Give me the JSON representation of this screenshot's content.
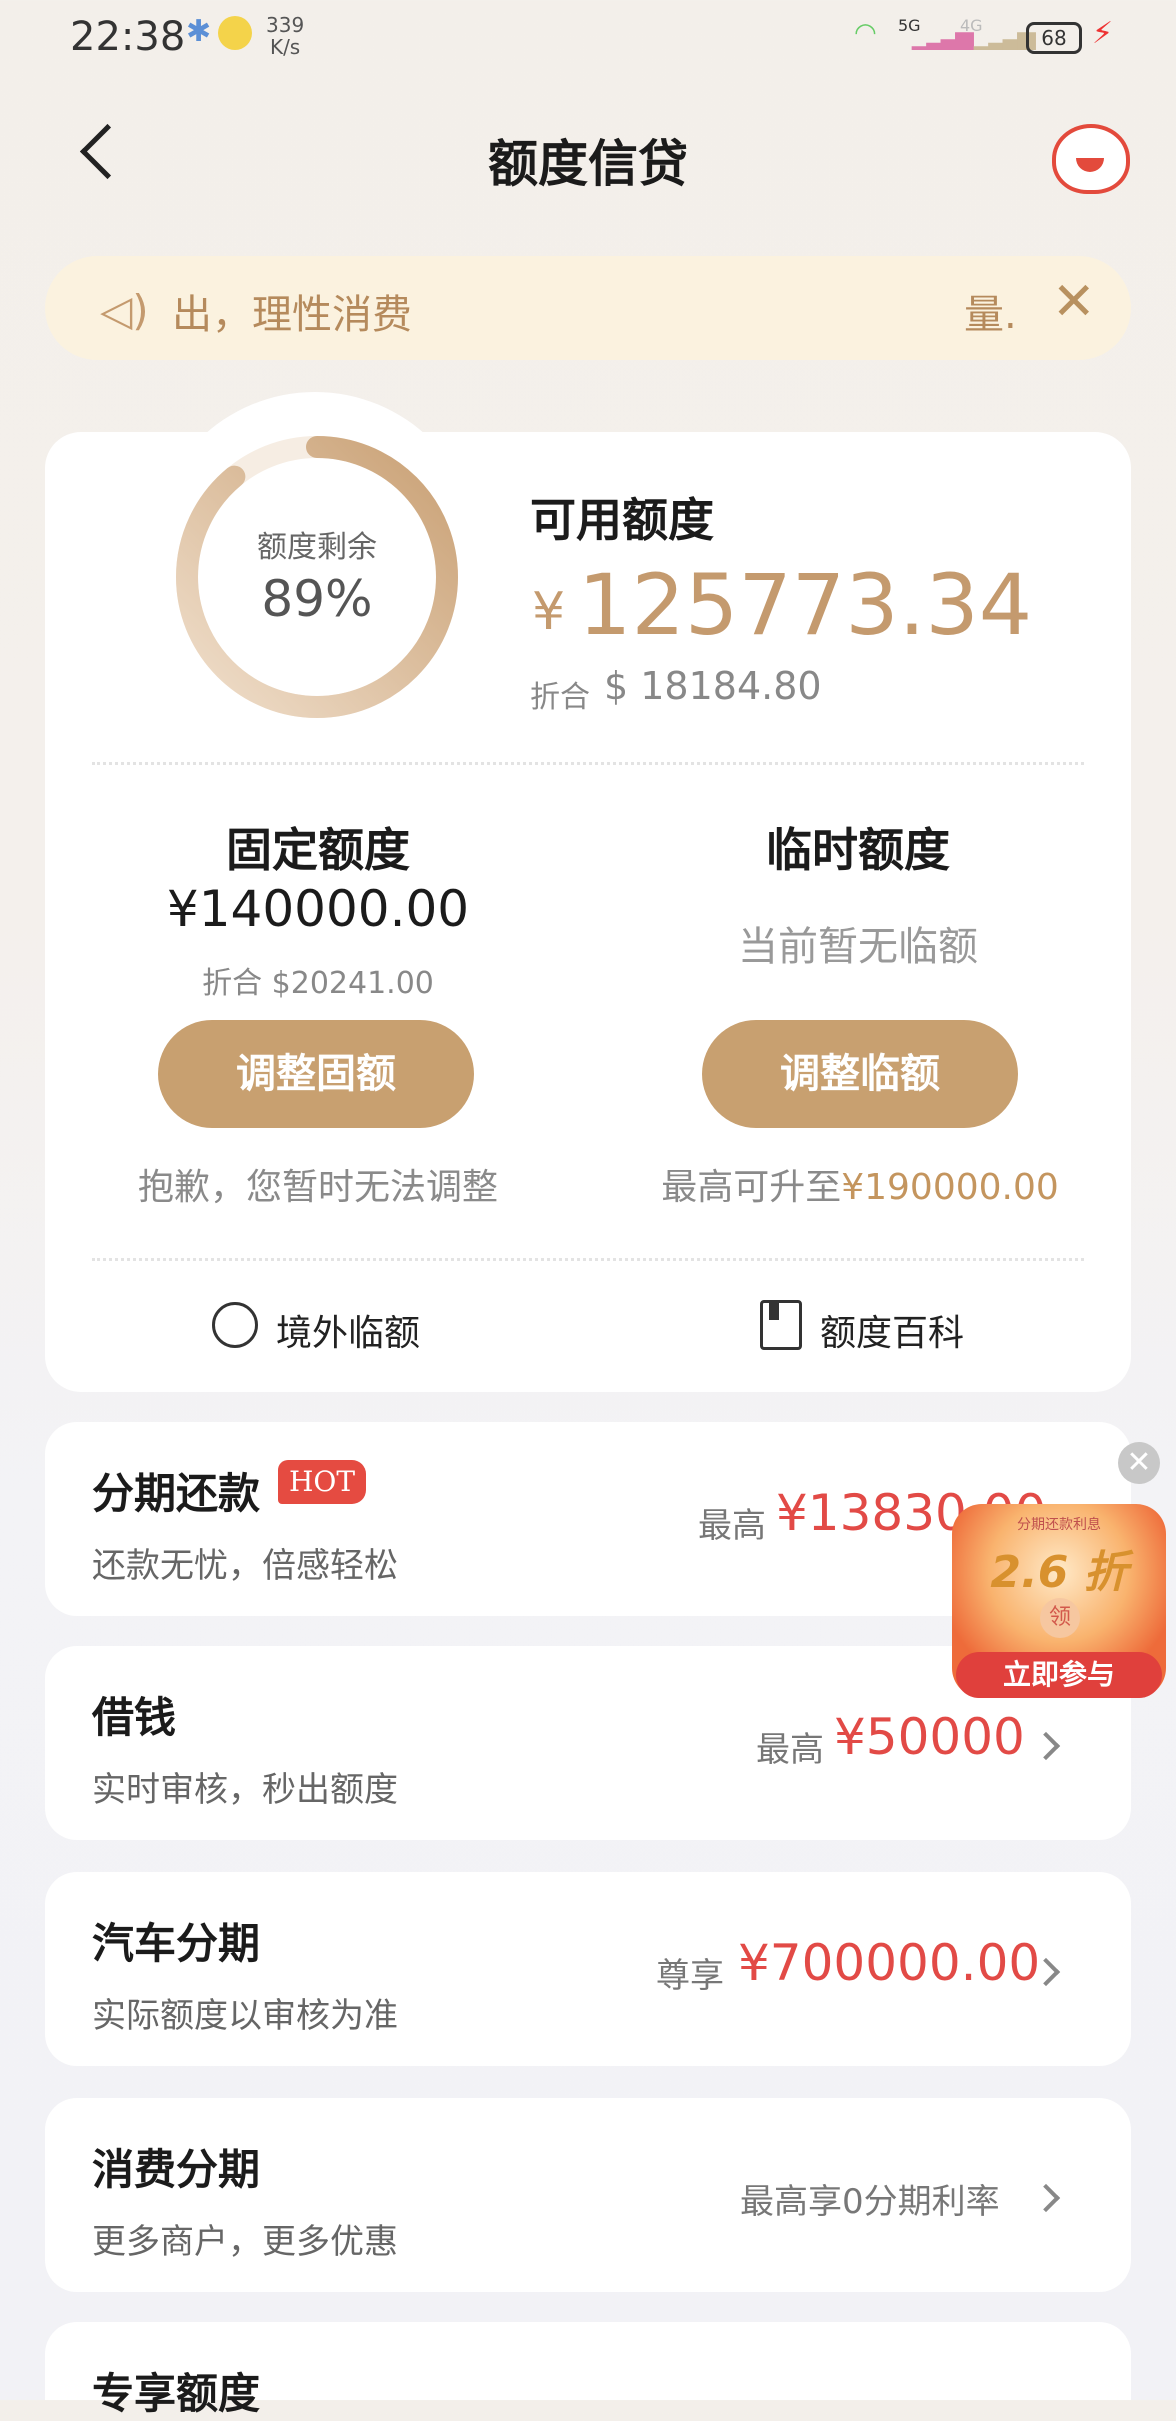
{
  "status_bar": {
    "time": "22:38",
    "net_speed_value": "339",
    "net_speed_unit": "K/s",
    "net_5g": "5G",
    "net_4g": "4G",
    "battery": "68"
  },
  "header": {
    "title": "额度信贷"
  },
  "notice": {
    "text": "出，理性消费",
    "tail": "量.",
    "icon": "speaker-icon"
  },
  "credit": {
    "ring_label": "额度剩余",
    "ring_percent_text": "89%",
    "ring_fraction": 0.89,
    "available_label": "可用额度",
    "currency_symbol": "¥",
    "available_value": "125773.34",
    "usd_label": "折合",
    "usd_value": "$ 18184.80"
  },
  "fixed_limit": {
    "title": "固定额度",
    "value": "¥140000.00",
    "usd": "折合 $20241.00",
    "button": "调整固额",
    "note": "抱歉，您暂时无法调整"
  },
  "temp_limit": {
    "title": "临时额度",
    "status": "当前暂无临额",
    "button": "调整临额",
    "note_prefix": "最高可升至",
    "note_amount": "¥190000.00"
  },
  "links": {
    "overseas": "境外临额",
    "encyclopedia": "额度百科"
  },
  "services": [
    {
      "title": "分期还款",
      "badge": "HOT",
      "subtitle": "还款无忧，倍感轻松",
      "prefix": "最高",
      "amount": "¥13830.00"
    },
    {
      "title": "借钱",
      "subtitle": "实时审核，秒出额度",
      "prefix": "最高",
      "amount": "¥50000"
    },
    {
      "title": "汽车分期",
      "subtitle": "实际额度以审核为准",
      "prefix": "尊享",
      "amount": "¥700000.00"
    },
    {
      "title": "消费分期",
      "subtitle": "更多商户，更多优惠",
      "prefix": "最高享0分期利率"
    },
    {
      "title": "专享额度"
    }
  ],
  "promo": {
    "top_text": "分期还款利息",
    "rate": "2.6 折",
    "badge": "领",
    "cta": "立即参与"
  },
  "colors": {
    "gold": "#c8a070",
    "red": "#e24a46",
    "notice_bg": "#fbf2df"
  }
}
